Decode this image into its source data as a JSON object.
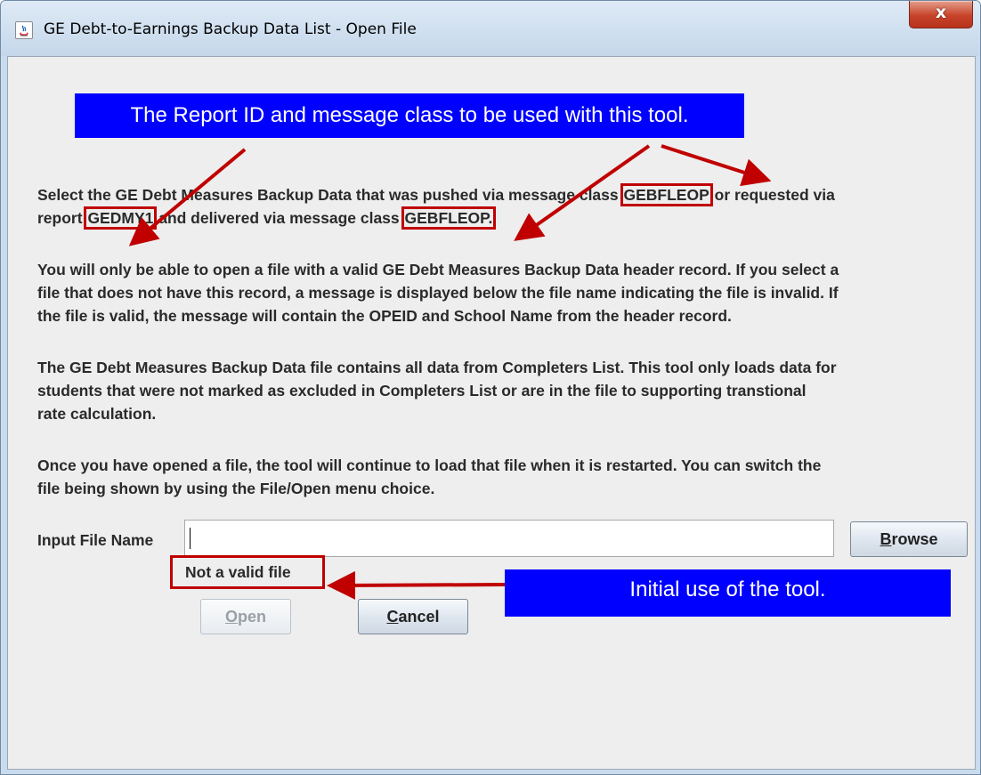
{
  "window": {
    "title": "GE Debt-to-Earnings Backup Data List  - Open File",
    "close_label": "x"
  },
  "callouts": {
    "top": "The Report ID and message class to be used with this tool.",
    "bottom": "Initial use of the tool."
  },
  "paragraphs": {
    "p1_line1_pre": "Select the GE Debt Measures Backup Data that was pushed via message class ",
    "p1_msgclass_1": "GEBFLEOP",
    "p1_line1_post": " or requested via",
    "p1_line2_pre": "report ",
    "p1_report_id": "GEDMY1",
    "p1_line2_mid": " and delivered via message class ",
    "p1_msgclass_2": "GEBFLEOP.",
    "p2_lines": [
      "You will only be able to open a file with a valid GE Debt Measures Backup Data header record. If you select a",
      "file that does not have this record, a message is displayed below the file name indicating the file is invalid. If",
      "the file is valid, the message will contain the OPEID and School Name from the header record."
    ],
    "p3_lines": [
      "The GE Debt Measures Backup Data file contains all data from Completers List. This tool only loads data for",
      "students that were not marked as excluded in Completers List or are in the file to supporting transtional",
      "rate calculation."
    ],
    "p4_lines": [
      "Once you have opened a file, the tool will continue to load that file when it is restarted. You can switch the",
      "file being shown by using the File/Open menu choice."
    ]
  },
  "form": {
    "input_label": "Input File Name",
    "input_value": "",
    "browse": {
      "mnemonic": "B",
      "rest": "rowse"
    },
    "status_message": "Not a valid file",
    "open": {
      "mnemonic": "O",
      "rest": "pen",
      "enabled": false
    },
    "cancel": {
      "mnemonic": "C",
      "rest": "ancel"
    }
  },
  "colors": {
    "callout_bg": "#0000ff",
    "highlight_box": "#c00000",
    "arrow": "#c00000"
  }
}
